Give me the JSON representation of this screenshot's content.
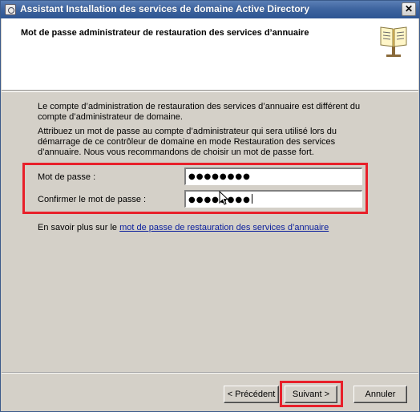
{
  "window": {
    "title": "Assistant Installation des services de domaine Active Directory",
    "close_label": "✕"
  },
  "header": {
    "heading": "Mot de passe administrateur de restauration des services d’annuaire",
    "icon": "book-icon"
  },
  "content": {
    "paragraph1": "Le compte d’administration de restauration des services d’annuaire est différent du compte d’administrateur de domaine.",
    "paragraph2": "Attribuez un mot de passe au compte d’administrateur qui sera utilisé lors du démarrage de ce contrôleur de domaine en mode Restauration des services d’annuaire. Nous vous recommandons de choisir un mot de passe fort.",
    "password_label": "Mot de passe :",
    "password_value": "●●●●●●●●",
    "confirm_label": "Confirmer le mot de passe :",
    "confirm_value": "●●●●●●●●",
    "learn_prefix": "En savoir plus sur le ",
    "learn_link": "mot de passe de restauration des services d’annuaire"
  },
  "buttons": {
    "previous": "< Précédent",
    "next": "Suivant >",
    "cancel": "Annuler"
  },
  "colors": {
    "highlight": "#e8202a",
    "titlebar": "#3f65a0",
    "link": "#0a1e9c"
  }
}
